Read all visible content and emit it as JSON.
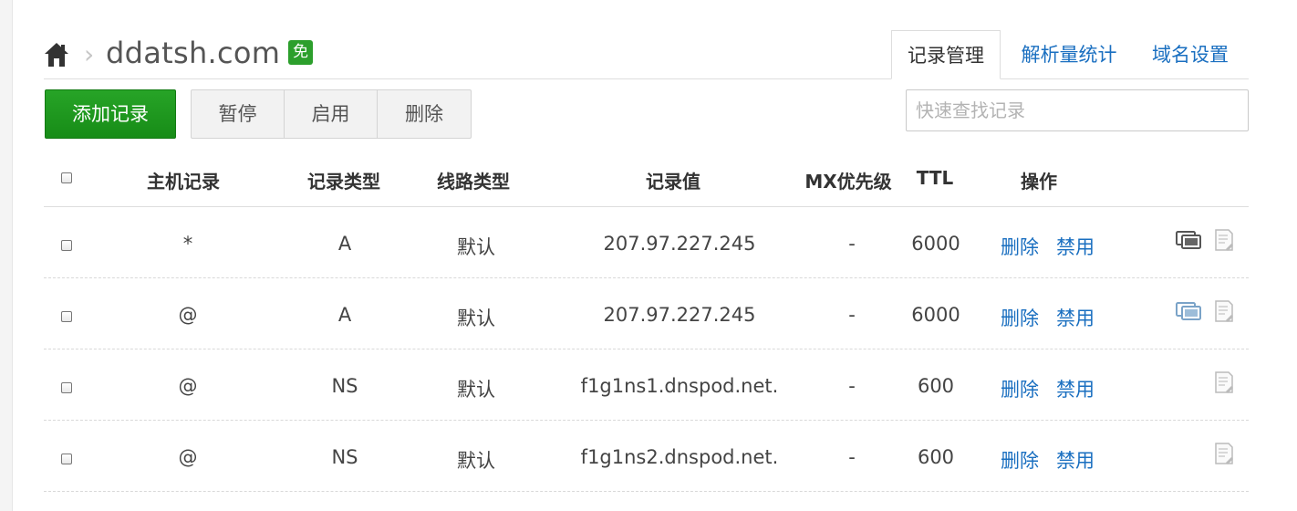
{
  "header": {
    "domain": "ddatsh.com",
    "breadcrumb_sep": "›",
    "free_badge": "免"
  },
  "tabs": [
    {
      "label": "记录管理",
      "active": true
    },
    {
      "label": "解析量统计",
      "active": false
    },
    {
      "label": "域名设置",
      "active": false
    }
  ],
  "toolbar": {
    "add_label": "添加记录",
    "pause_label": "暂停",
    "enable_label": "启用",
    "delete_label": "删除",
    "search_placeholder": "快速查找记录"
  },
  "table": {
    "columns": {
      "host": "主机记录",
      "type": "记录类型",
      "line": "线路类型",
      "value": "记录值",
      "mx": "MX优先级",
      "ttl": "TTL",
      "ops": "操作"
    },
    "rows": [
      {
        "host": "*",
        "type": "A",
        "line": "默认",
        "value": "207.97.227.245",
        "mx": "-",
        "ttl": "6000",
        "delete": "删除",
        "disable": "禁用",
        "monitor_icon": "monitor-icon",
        "monitor_color": "#555555",
        "remark_icon": "remark-icon"
      },
      {
        "host": "@",
        "type": "A",
        "line": "默认",
        "value": "207.97.227.245",
        "mx": "-",
        "ttl": "6000",
        "delete": "删除",
        "disable": "禁用",
        "monitor_icon": "monitor-icon",
        "monitor_color": "#7aa3c8",
        "remark_icon": "remark-icon"
      },
      {
        "host": "@",
        "type": "NS",
        "line": "默认",
        "value": "f1g1ns1.dnspod.net.",
        "mx": "-",
        "ttl": "600",
        "delete": "删除",
        "disable": "禁用",
        "remark_icon": "remark-icon"
      },
      {
        "host": "@",
        "type": "NS",
        "line": "默认",
        "value": "f1g1ns2.dnspod.net.",
        "mx": "-",
        "ttl": "600",
        "delete": "删除",
        "disable": "禁用",
        "remark_icon": "remark-icon"
      }
    ]
  },
  "colors": {
    "accent_green": "#1f9a1f",
    "link_blue": "#1a6fc0"
  }
}
